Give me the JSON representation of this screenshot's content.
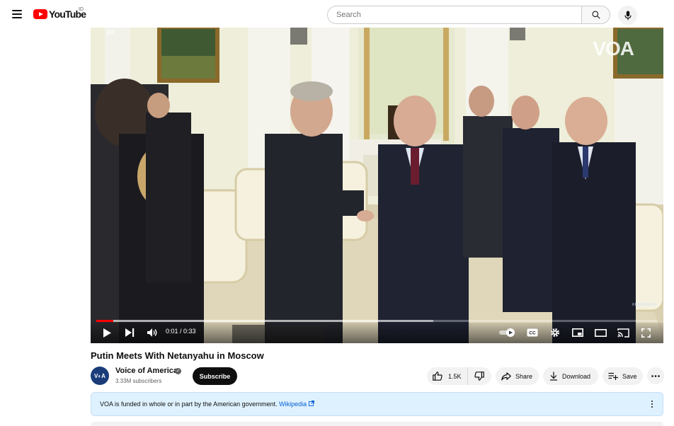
{
  "header": {
    "logo_text": "YouTube",
    "country_code": "ID",
    "search_placeholder": "Search"
  },
  "player": {
    "watermark_brand": "VOA",
    "watermark_source": "AP",
    "watermark_kremlin": "KREMLIN.RU",
    "time_display": "0:01 / 0:33",
    "progress_fraction": 0.03,
    "buffer_fraction": 0.6,
    "controls": [
      "play-icon",
      "next-icon",
      "volume-icon",
      "autoplay-toggle",
      "captions-icon",
      "settings-icon",
      "miniplayer-icon",
      "theater-icon",
      "cast-icon",
      "fullscreen-icon"
    ],
    "captions_label": "CC"
  },
  "video": {
    "title": "Putin Meets With Netanyahu in Moscow"
  },
  "channel": {
    "name": "Voice of America",
    "avatar_text": "V◐A",
    "subscribers": "3.33M subscribers",
    "subscribe_label": "Subscribe"
  },
  "actions": {
    "like_count": "1.5K",
    "share_label": "Share",
    "download_label": "Download",
    "save_label": "Save"
  },
  "funding": {
    "text": "VOA is funded in whole or in part by the American government.",
    "link_text": "Wikipedia"
  },
  "colors": {
    "brand_red": "#ff0000",
    "link_blue": "#065fd4",
    "funding_bg": "#def1ff"
  }
}
